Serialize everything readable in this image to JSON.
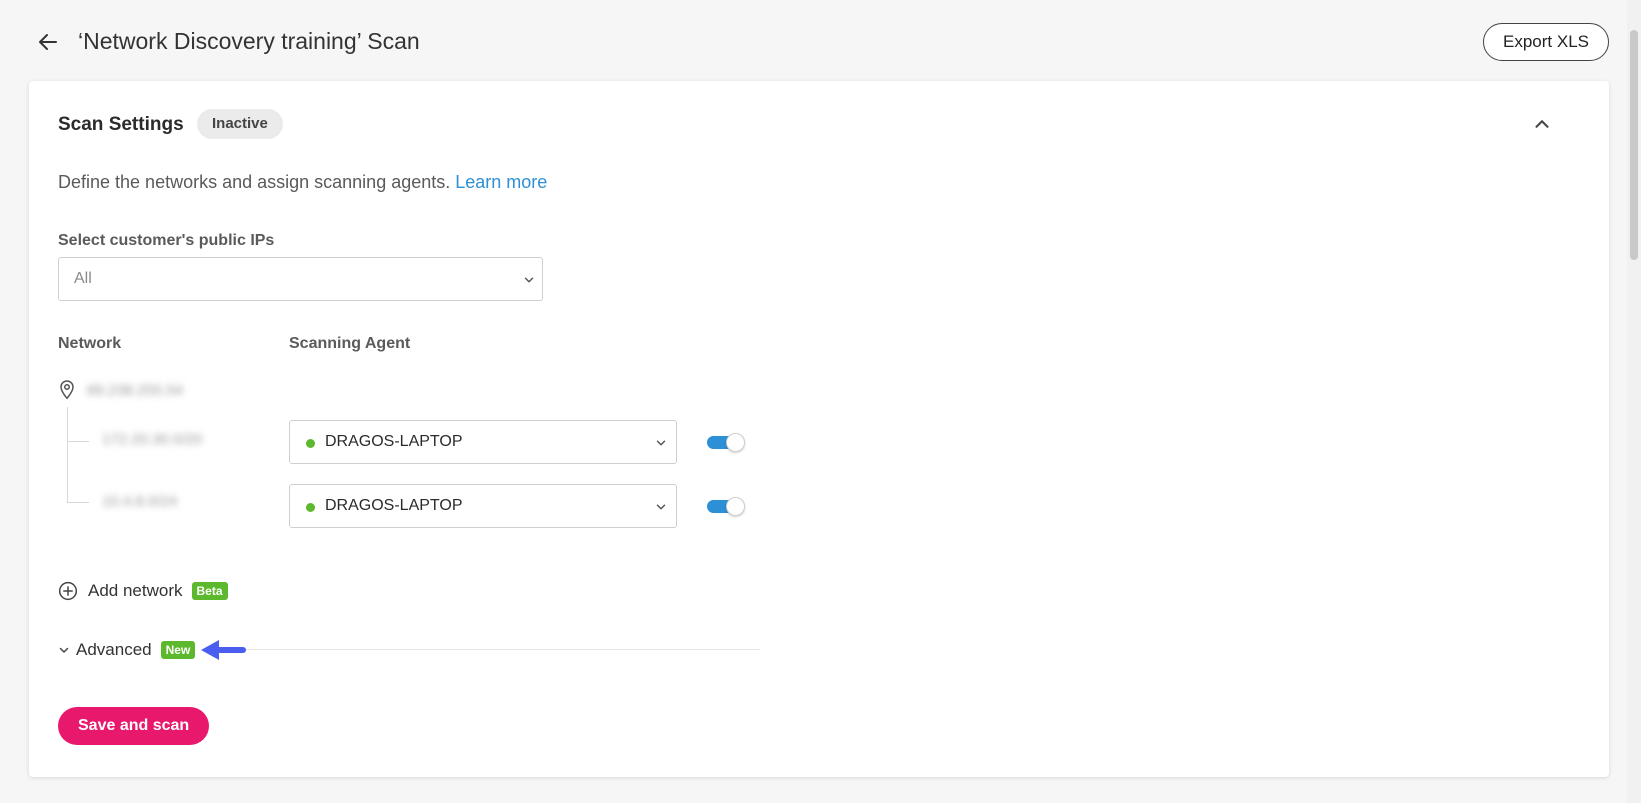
{
  "header": {
    "title": "‘Network Discovery training’ Scan",
    "export_label": "Export XLS"
  },
  "settings": {
    "title": "Scan Settings",
    "status": "Inactive",
    "description": "Define the networks and assign scanning agents.",
    "learn_more": "Learn more",
    "public_ips_label": "Select customer's public IPs",
    "public_ips_value": "All",
    "columns": {
      "network": "Network",
      "agent": "Scanning Agent"
    },
    "public_network": "89.238.255.54",
    "subnets": [
      {
        "network": "172.20.30.0/20",
        "agent": "DRAGOS-LAPTOP",
        "enabled": true
      },
      {
        "network": "10.4.8.0/24",
        "agent": "DRAGOS-LAPTOP",
        "enabled": true
      }
    ],
    "add_network_label": "Add network",
    "add_network_badge": "Beta",
    "advanced_label": "Advanced",
    "advanced_badge": "New",
    "save_label": "Save and scan"
  },
  "colors": {
    "accent_blue": "#2d8fd5",
    "primary_pink": "#e8186d",
    "online_green": "#5cb82c",
    "badge_green": "#5cb82c",
    "pointer_arrow": "#4a5ef0"
  }
}
